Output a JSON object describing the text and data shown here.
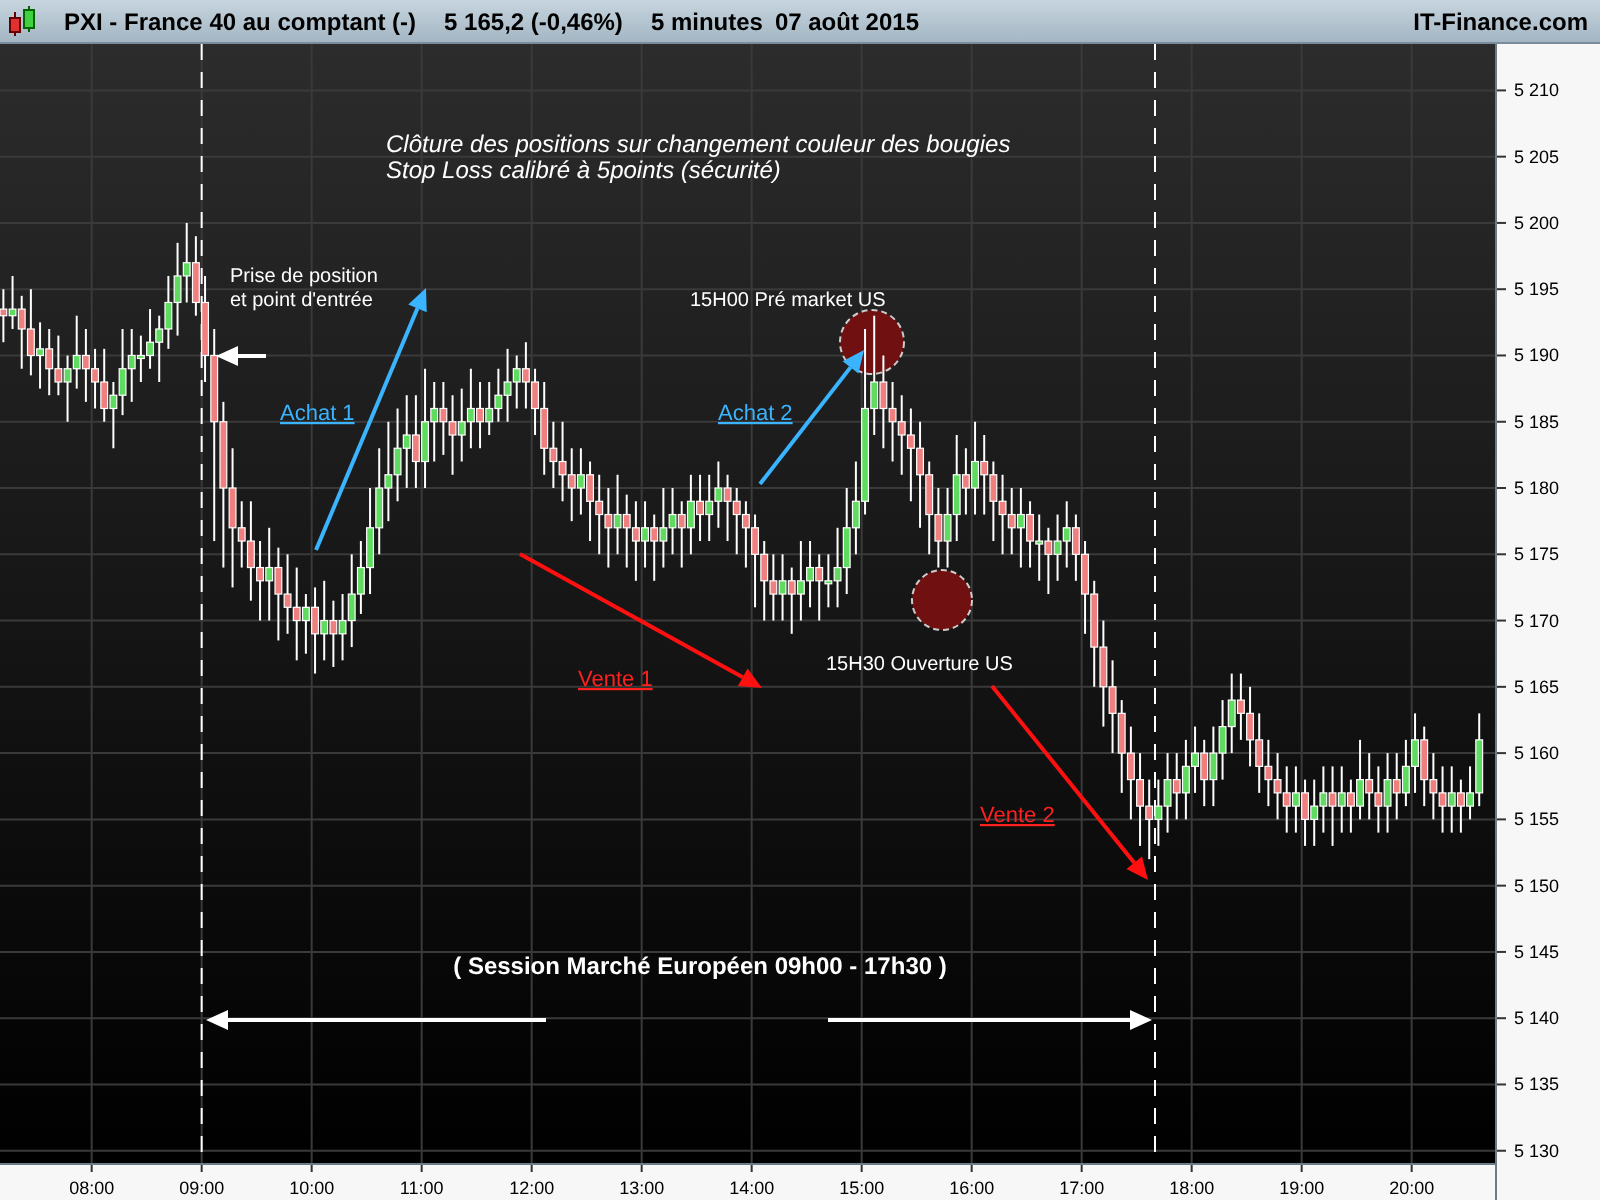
{
  "header": {
    "symbol": "PXI - France 40 au comptant (-)",
    "price": "5 165,2 (-0,46%)",
    "interval": "5 minutes",
    "date": "07 août 2015",
    "brand": "IT-Finance.com"
  },
  "chart_data": {
    "type": "candlestick",
    "xlim": [
      430,
      1246
    ],
    "ylim": [
      5129,
      5213.5
    ],
    "grid": true,
    "ref_lines": [
      {
        "axis": "x",
        "value": 540
      },
      {
        "axis": "x",
        "value": 1060
      }
    ],
    "yticks": [
      {
        "value": 5210,
        "label": "5 210"
      },
      {
        "value": 5205,
        "label": "5 205"
      },
      {
        "value": 5200,
        "label": "5 200"
      },
      {
        "value": 5195,
        "label": "5 195"
      },
      {
        "value": 5190,
        "label": "5 190"
      },
      {
        "value": 5185,
        "label": "5 185"
      },
      {
        "value": 5180,
        "label": "5 180"
      },
      {
        "value": 5175,
        "label": "5 175"
      },
      {
        "value": 5170,
        "label": "5 170"
      },
      {
        "value": 5165,
        "label": "5 165"
      },
      {
        "value": 5160,
        "label": "5 160"
      },
      {
        "value": 5155,
        "label": "5 155"
      },
      {
        "value": 5150,
        "label": "5 150"
      },
      {
        "value": 5145,
        "label": "5 145"
      },
      {
        "value": 5140,
        "label": "5 140"
      },
      {
        "value": 5135,
        "label": "5 135"
      },
      {
        "value": 5130,
        "label": "5 130"
      }
    ],
    "xticks": [
      {
        "value": 480,
        "label": "08:00"
      },
      {
        "value": 540,
        "label": "09:00"
      },
      {
        "value": 600,
        "label": "10:00"
      },
      {
        "value": 660,
        "label": "11:00"
      },
      {
        "value": 720,
        "label": "12:00"
      },
      {
        "value": 780,
        "label": "13:00"
      },
      {
        "value": 840,
        "label": "14:00"
      },
      {
        "value": 900,
        "label": "15:00"
      },
      {
        "value": 960,
        "label": "16:00"
      },
      {
        "value": 1020,
        "label": "17:00"
      },
      {
        "value": 1080,
        "label": "18:00"
      },
      {
        "value": 1140,
        "label": "19:00"
      },
      {
        "value": 1200,
        "label": "20:00"
      }
    ],
    "x": [
      430,
      435,
      440,
      445,
      450,
      455,
      460,
      465,
      470,
      475,
      480,
      485,
      490,
      495,
      500,
      505,
      510,
      515,
      520,
      525,
      530,
      535,
      540,
      545,
      550,
      555,
      560,
      565,
      570,
      575,
      580,
      585,
      590,
      595,
      600,
      605,
      610,
      615,
      620,
      625,
      630,
      635,
      640,
      645,
      650,
      655,
      660,
      665,
      670,
      675,
      680,
      685,
      690,
      695,
      700,
      705,
      710,
      715,
      720,
      725,
      730,
      735,
      740,
      745,
      750,
      755,
      760,
      765,
      770,
      775,
      780,
      785,
      790,
      795,
      800,
      805,
      810,
      815,
      820,
      825,
      830,
      835,
      840,
      845,
      850,
      855,
      860,
      865,
      870,
      875,
      880,
      885,
      890,
      895,
      900,
      905,
      910,
      915,
      920,
      925,
      930,
      935,
      940,
      945,
      950,
      955,
      960,
      965,
      970,
      975,
      980,
      985,
      990,
      995,
      1000,
      1005,
      1010,
      1015,
      1020,
      1025,
      1030,
      1035,
      1040,
      1045,
      1050,
      1055,
      1060,
      1065,
      1070,
      1075,
      1080,
      1085,
      1090,
      1095,
      1100,
      1105,
      1110,
      1115,
      1120,
      1125,
      1130,
      1135,
      1140,
      1145,
      1150,
      1155,
      1160,
      1165,
      1170,
      1175,
      1180,
      1185,
      1190,
      1195,
      1200,
      1205,
      1210,
      1215,
      1220,
      1225,
      1230,
      1235
    ],
    "ohlc": [
      [
        5193.5,
        5195,
        5191,
        5193
      ],
      [
        5193,
        5196,
        5192,
        5193.5
      ],
      [
        5193.5,
        5194.5,
        5189,
        5192
      ],
      [
        5192,
        5195,
        5188.5,
        5190
      ],
      [
        5190,
        5192.5,
        5187.5,
        5190.5
      ],
      [
        5190.5,
        5192,
        5187,
        5189
      ],
      [
        5189,
        5191.5,
        5187,
        5188
      ],
      [
        5188,
        5190,
        5185,
        5189
      ],
      [
        5189,
        5193,
        5187.5,
        5190
      ],
      [
        5190,
        5192,
        5186.5,
        5189
      ],
      [
        5189,
        5190.5,
        5186,
        5188
      ],
      [
        5188,
        5190.5,
        5185,
        5186
      ],
      [
        5186,
        5188,
        5183,
        5187
      ],
      [
        5187,
        5192,
        5185.5,
        5189
      ],
      [
        5189,
        5192,
        5186.5,
        5190
      ],
      [
        5190,
        5191.5,
        5188,
        5190
      ],
      [
        5190,
        5193.5,
        5189,
        5191
      ],
      [
        5191,
        5193,
        5188,
        5192
      ],
      [
        5192,
        5196,
        5190.5,
        5194
      ],
      [
        5194,
        5198.5,
        5191.5,
        5196
      ],
      [
        5196,
        5200,
        5194,
        5197
      ],
      [
        5197,
        5199,
        5193,
        5194
      ],
      [
        5194,
        5196,
        5188,
        5190
      ],
      [
        5190,
        5192,
        5176,
        5185
      ],
      [
        5185,
        5186.5,
        5174,
        5180
      ],
      [
        5180,
        5183,
        5172.5,
        5177
      ],
      [
        5177,
        5179,
        5174,
        5176
      ],
      [
        5176,
        5179,
        5171.5,
        5174
      ],
      [
        5174,
        5176,
        5170,
        5173
      ],
      [
        5173,
        5177,
        5170,
        5174
      ],
      [
        5174,
        5175.5,
        5168.5,
        5172
      ],
      [
        5172,
        5175,
        5169,
        5171
      ],
      [
        5171,
        5174,
        5167,
        5170
      ],
      [
        5170,
        5172,
        5167.5,
        5171
      ],
      [
        5171,
        5172.5,
        5166,
        5169
      ],
      [
        5169,
        5173,
        5167,
        5170
      ],
      [
        5170,
        5171.5,
        5166.5,
        5169
      ],
      [
        5169,
        5172,
        5167,
        5170
      ],
      [
        5170,
        5175,
        5168,
        5172
      ],
      [
        5172,
        5176,
        5170.5,
        5174
      ],
      [
        5174,
        5180,
        5172,
        5177
      ],
      [
        5177,
        5183,
        5175,
        5180
      ],
      [
        5180,
        5185,
        5177.5,
        5181
      ],
      [
        5181,
        5186,
        5179,
        5183
      ],
      [
        5183,
        5187,
        5180,
        5184
      ],
      [
        5184,
        5187,
        5180,
        5182
      ],
      [
        5182,
        5189,
        5180,
        5185
      ],
      [
        5185,
        5188,
        5182,
        5186
      ],
      [
        5186,
        5188,
        5182.5,
        5185
      ],
      [
        5185,
        5187,
        5181,
        5184
      ],
      [
        5184,
        5187.5,
        5182,
        5185
      ],
      [
        5185,
        5189,
        5183,
        5186
      ],
      [
        5186,
        5188,
        5183,
        5185
      ],
      [
        5185,
        5188,
        5184,
        5186
      ],
      [
        5186,
        5189,
        5185,
        5187
      ],
      [
        5187,
        5190.5,
        5185,
        5188
      ],
      [
        5188,
        5190,
        5186,
        5189
      ],
      [
        5189,
        5191,
        5186,
        5188
      ],
      [
        5188,
        5189,
        5184,
        5186
      ],
      [
        5186,
        5188,
        5181,
        5183
      ],
      [
        5183,
        5185,
        5180,
        5182
      ],
      [
        5182,
        5185,
        5179,
        5181
      ],
      [
        5181,
        5183,
        5177.5,
        5180
      ],
      [
        5180,
        5183,
        5178,
        5181
      ],
      [
        5181,
        5182,
        5176,
        5179
      ],
      [
        5179,
        5181,
        5175,
        5178
      ],
      [
        5178,
        5180,
        5174,
        5177
      ],
      [
        5177,
        5181,
        5175,
        5178
      ],
      [
        5178,
        5179.5,
        5174,
        5177
      ],
      [
        5177,
        5179,
        5173,
        5176
      ],
      [
        5176,
        5179,
        5174,
        5177
      ],
      [
        5177,
        5178,
        5173,
        5176
      ],
      [
        5176,
        5180,
        5174,
        5177
      ],
      [
        5177,
        5180,
        5175,
        5178
      ],
      [
        5178,
        5179,
        5174,
        5177
      ],
      [
        5177,
        5181,
        5175,
        5179
      ],
      [
        5179,
        5181,
        5176,
        5178
      ],
      [
        5178,
        5181,
        5176,
        5179
      ],
      [
        5179,
        5182,
        5177,
        5180
      ],
      [
        5180,
        5181,
        5176,
        5179
      ],
      [
        5179,
        5180,
        5175,
        5178
      ],
      [
        5178,
        5179,
        5174,
        5177
      ],
      [
        5177,
        5178,
        5171,
        5175
      ],
      [
        5175,
        5176,
        5170,
        5173
      ],
      [
        5173,
        5175,
        5170,
        5172
      ],
      [
        5172,
        5175,
        5170,
        5173
      ],
      [
        5173,
        5174,
        5169,
        5172
      ],
      [
        5172,
        5176,
        5170,
        5173
      ],
      [
        5173,
        5176,
        5171,
        5174
      ],
      [
        5174,
        5175,
        5170,
        5173
      ],
      [
        5173,
        5175,
        5171,
        5173
      ],
      [
        5173,
        5177,
        5171,
        5174
      ],
      [
        5174,
        5180,
        5172,
        5177
      ],
      [
        5177,
        5182,
        5175,
        5179
      ],
      [
        5179,
        5192,
        5178,
        5186
      ],
      [
        5186,
        5193,
        5184,
        5188
      ],
      [
        5188,
        5190,
        5183,
        5186
      ],
      [
        5186,
        5188,
        5182,
        5185
      ],
      [
        5185,
        5187,
        5181,
        5184
      ],
      [
        5184,
        5186,
        5179,
        5183
      ],
      [
        5183,
        5185,
        5177,
        5181
      ],
      [
        5181,
        5182,
        5175,
        5178
      ],
      [
        5178,
        5180,
        5174,
        5176
      ],
      [
        5176,
        5180,
        5174,
        5178
      ],
      [
        5178,
        5184,
        5176,
        5181
      ],
      [
        5181,
        5183,
        5178,
        5180
      ],
      [
        5180,
        5185,
        5178,
        5182
      ],
      [
        5182,
        5184,
        5178,
        5181
      ],
      [
        5181,
        5182,
        5176,
        5179
      ],
      [
        5179,
        5181,
        5175,
        5178
      ],
      [
        5178,
        5180,
        5175,
        5177
      ],
      [
        5177,
        5180,
        5174,
        5178
      ],
      [
        5178,
        5179,
        5174,
        5176
      ],
      [
        5176,
        5178,
        5173,
        5176
      ],
      [
        5176,
        5177,
        5172,
        5175
      ],
      [
        5175,
        5178,
        5173,
        5176
      ],
      [
        5176,
        5179,
        5174,
        5177
      ],
      [
        5177,
        5178,
        5173,
        5175
      ],
      [
        5175,
        5176,
        5169,
        5172
      ],
      [
        5172,
        5173,
        5165,
        5168
      ],
      [
        5168,
        5170,
        5162,
        5165
      ],
      [
        5165,
        5167,
        5160,
        5163
      ],
      [
        5163,
        5164,
        5157,
        5160
      ],
      [
        5160,
        5162,
        5155,
        5158
      ],
      [
        5158,
        5160,
        5153,
        5156
      ],
      [
        5156,
        5158,
        5152,
        5155
      ],
      [
        5155,
        5158,
        5153,
        5156
      ],
      [
        5156,
        5160,
        5154,
        5158
      ],
      [
        5158,
        5160,
        5155,
        5157
      ],
      [
        5157,
        5161,
        5155,
        5159
      ],
      [
        5159,
        5162,
        5157,
        5160
      ],
      [
        5160,
        5161,
        5156,
        5158
      ],
      [
        5158,
        5162,
        5156,
        5160
      ],
      [
        5160,
        5164,
        5158,
        5162
      ],
      [
        5162,
        5166,
        5160,
        5164
      ],
      [
        5164,
        5166,
        5161,
        5163
      ],
      [
        5163,
        5165,
        5159,
        5161
      ],
      [
        5161,
        5163,
        5157,
        5159
      ],
      [
        5159,
        5161,
        5156,
        5158
      ],
      [
        5158,
        5160,
        5155,
        5157
      ],
      [
        5157,
        5159,
        5154,
        5156
      ],
      [
        5156,
        5159,
        5154,
        5157
      ],
      [
        5157,
        5158,
        5153,
        5155
      ],
      [
        5155,
        5158,
        5153,
        5156
      ],
      [
        5156,
        5159,
        5154,
        5157
      ],
      [
        5157,
        5159,
        5153,
        5156
      ],
      [
        5156,
        5159,
        5154,
        5157
      ],
      [
        5157,
        5158,
        5154,
        5156
      ],
      [
        5156,
        5161,
        5155,
        5158
      ],
      [
        5158,
        5160,
        5155,
        5157
      ],
      [
        5157,
        5159,
        5154,
        5156
      ],
      [
        5156,
        5160,
        5154,
        5158
      ],
      [
        5158,
        5160,
        5155,
        5157
      ],
      [
        5157,
        5161,
        5156,
        5159
      ],
      [
        5159,
        5163,
        5157,
        5161
      ],
      [
        5161,
        5162,
        5156,
        5158
      ],
      [
        5158,
        5160,
        5155,
        5157
      ],
      [
        5157,
        5159,
        5154,
        5156
      ],
      [
        5156,
        5159,
        5154,
        5157
      ],
      [
        5157,
        5158,
        5154,
        5156
      ],
      [
        5156,
        5159,
        5155,
        5157
      ],
      [
        5157,
        5163,
        5156,
        5161
      ]
    ]
  },
  "annotations": [
    {
      "kind": "note",
      "text": "Clôture des positions sur changement couleur des bougies"
    },
    {
      "kind": "note",
      "text": "Stop Loss calibré à 5points (sécurité)"
    },
    {
      "kind": "label",
      "text": "Prise de position"
    },
    {
      "kind": "label",
      "text": "et point d'entrée"
    },
    {
      "kind": "buy",
      "text": "Achat 1"
    },
    {
      "kind": "label",
      "text": "15H00 Pré market US"
    },
    {
      "kind": "buy",
      "text": "Achat 2"
    },
    {
      "kind": "sell",
      "text": "Vente 1"
    },
    {
      "kind": "label",
      "text": "15H30 Ouverture US"
    },
    {
      "kind": "sell",
      "text": "Vente 2"
    },
    {
      "kind": "session",
      "text": "( Session Marché Européen  09h00 - 17h30 )"
    }
  ]
}
